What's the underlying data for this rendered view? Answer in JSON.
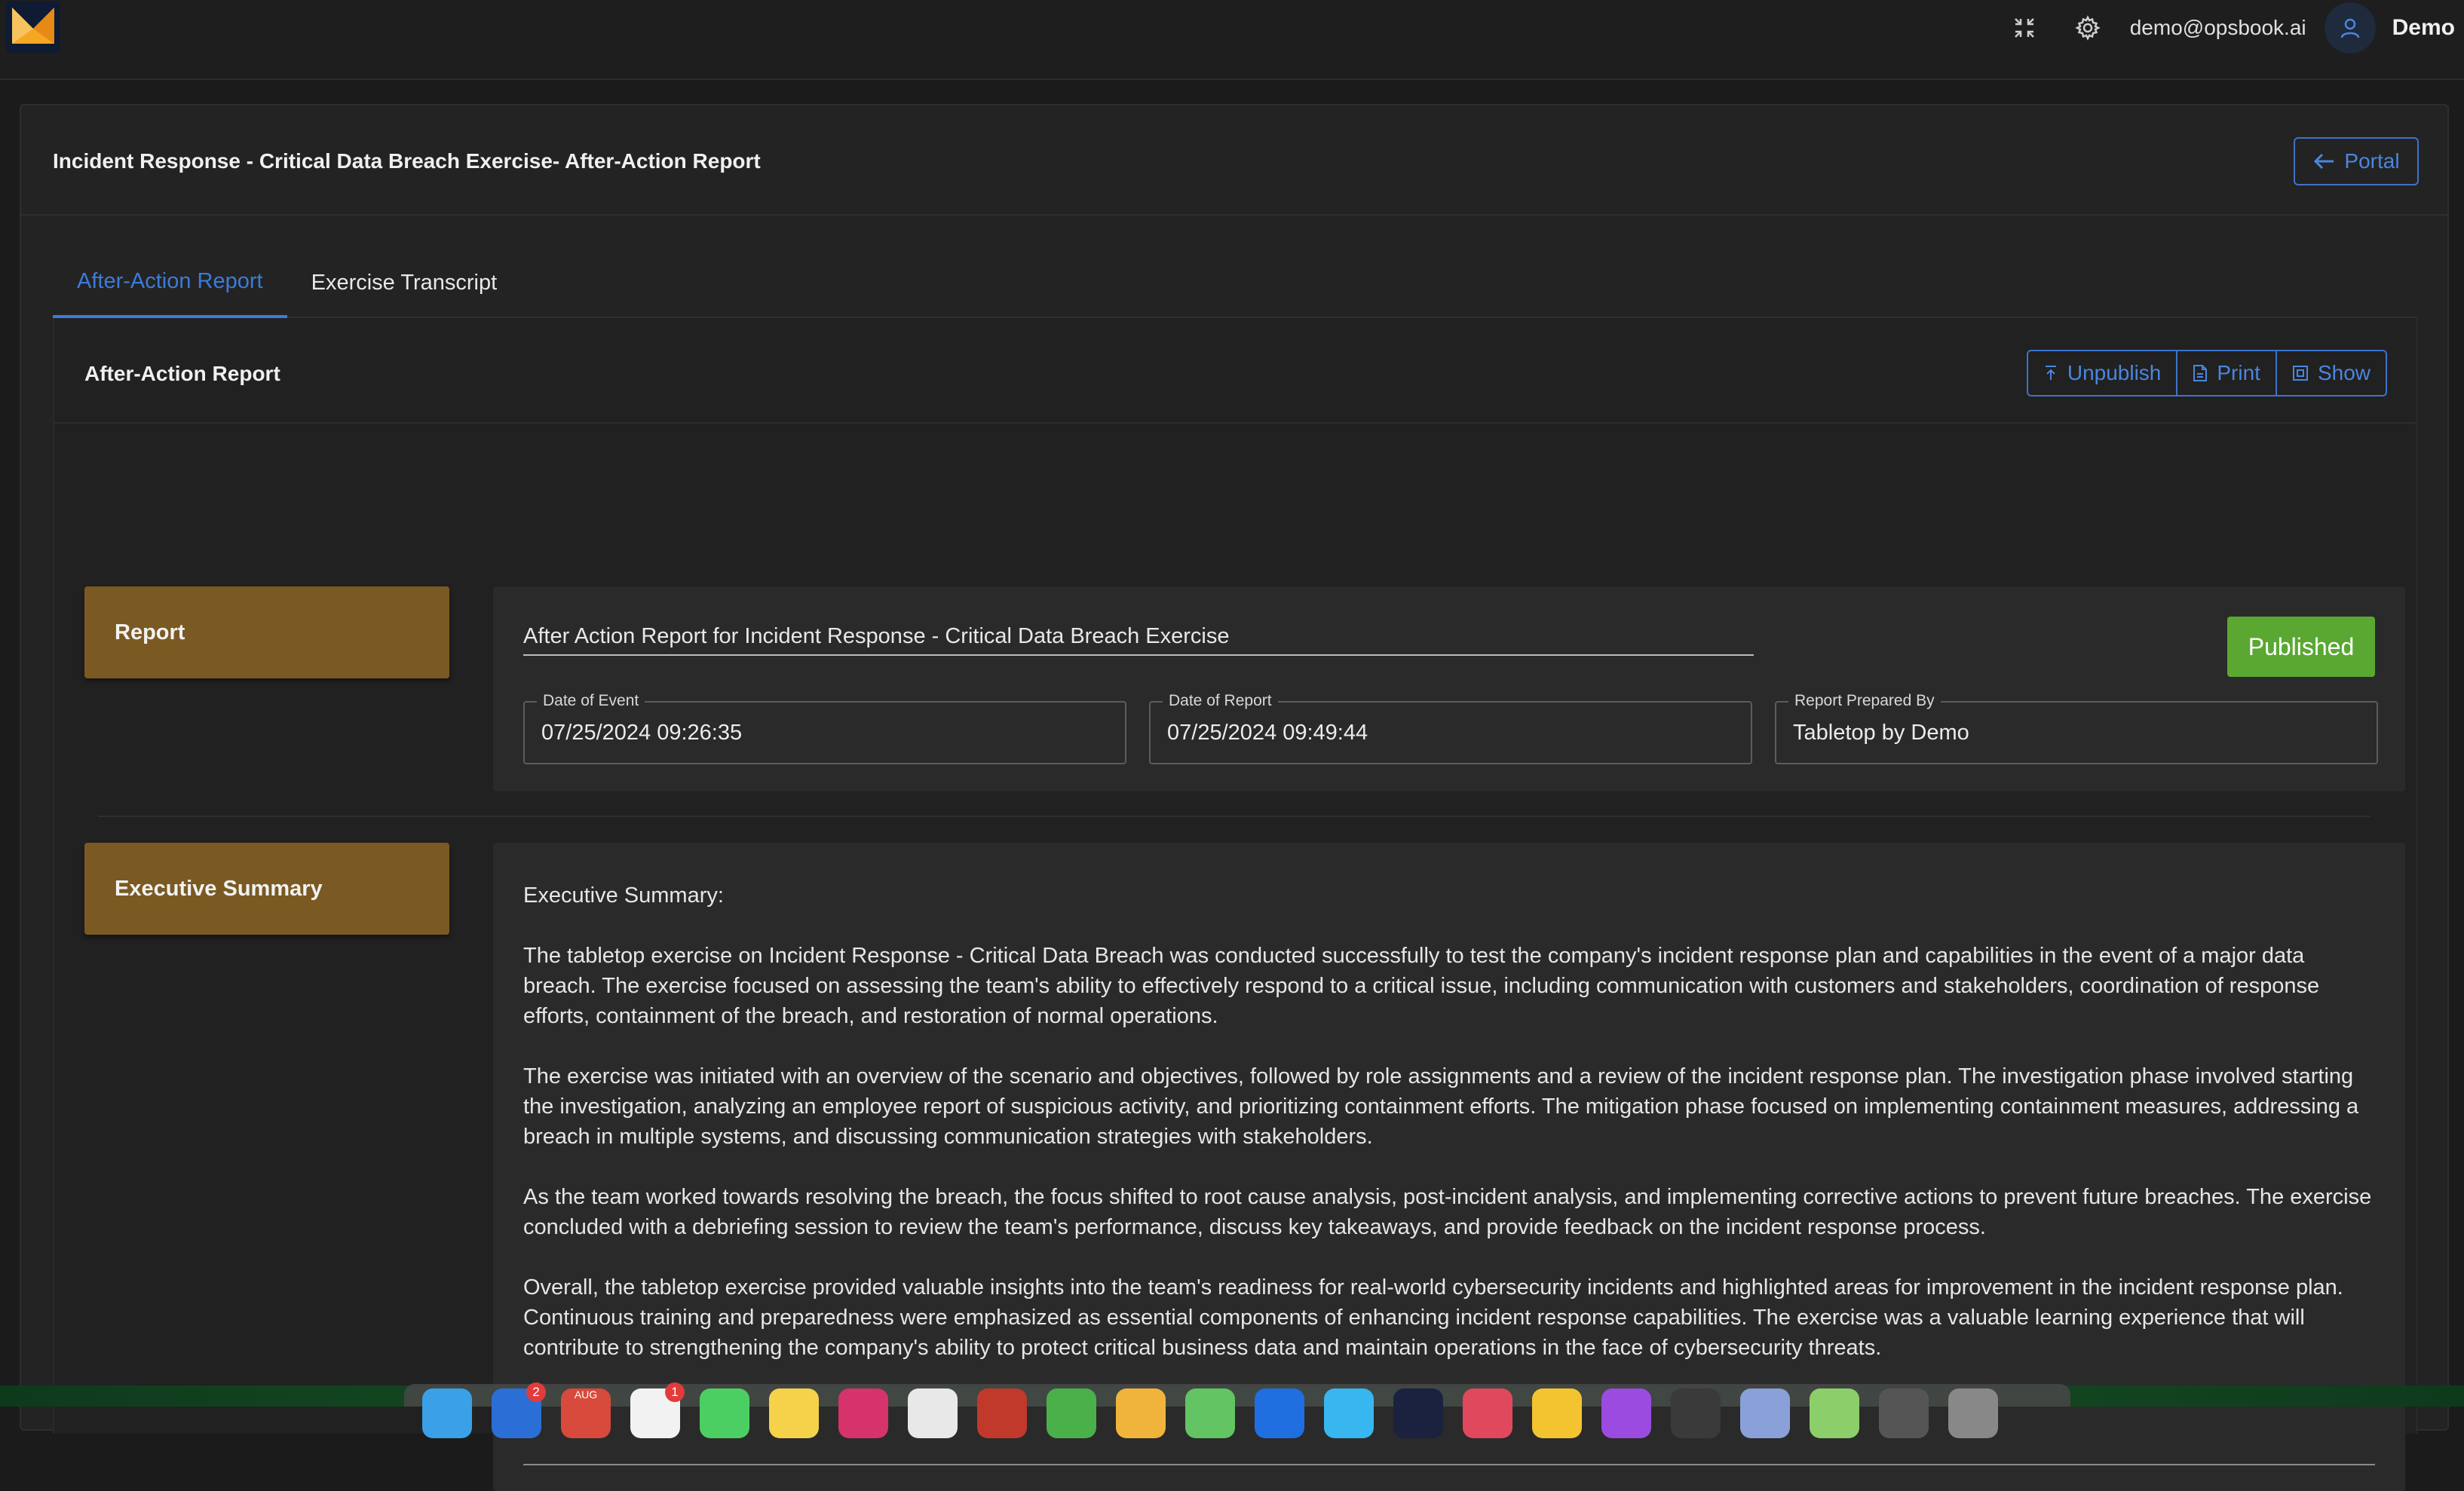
{
  "topbar": {
    "email": "demo@opsbook.ai",
    "username": "Demo",
    "icons": [
      "fullscreen-icon",
      "gear-icon",
      "user-icon"
    ]
  },
  "header": {
    "title": "Incident Response - Critical Data Breach Exercise- After-Action Report",
    "portal_label": "Portal"
  },
  "tabs": [
    {
      "label": "After-Action Report",
      "active": true
    },
    {
      "label": "Exercise Transcript",
      "active": false
    }
  ],
  "section": {
    "title": "After-Action Report",
    "buttons": {
      "unpublish": "Unpublish",
      "print": "Print",
      "show": "Show"
    }
  },
  "report": {
    "side_label": "Report",
    "title_value": "After Action Report for Incident Response -  Critical Data Breach Exercise",
    "status": "Published",
    "status_color": "#5aa832",
    "fields": {
      "date_of_event": {
        "label": "Date of Event",
        "value": "07/25/2024 09:26:35"
      },
      "date_of_report": {
        "label": "Date of Report",
        "value": "07/25/2024 09:49:44"
      },
      "prepared_by": {
        "label": "Report Prepared By",
        "value": "Tabletop by Demo"
      }
    }
  },
  "summary": {
    "side_label": "Executive Summary",
    "heading": "Executive Summary:",
    "paragraphs": [
      "The tabletop exercise on Incident Response - Critical Data Breach was conducted successfully to test the company's incident response plan and capabilities in the event of a major data breach. The exercise focused on assessing the team's ability to effectively respond to a critical issue, including communication with customers and stakeholders, coordination of response efforts, containment of the breach, and restoration of normal operations.",
      "The exercise was initiated with an overview of the scenario and objectives, followed by role assignments and a review of the incident response plan. The investigation phase involved starting the investigation, analyzing an employee report of suspicious activity, and prioritizing containment efforts. The mitigation phase focused on implementing containment measures, addressing a breach in multiple systems, and discussing communication strategies with stakeholders.",
      "As the team worked towards resolving the breach, the focus shifted to root cause analysis, post-incident analysis, and implementing corrective actions to prevent future breaches. The exercise concluded with a debriefing session to review the team's performance, discuss key takeaways, and provide feedback on the incident response process.",
      "Overall, the tabletop exercise provided valuable insights into the team's readiness for real-world cybersecurity incidents and highlighted areas for improvement in the incident response plan. Continuous training and preparedness were emphasized as essential components of enhancing incident response capabilities. The exercise was a valuable learning experience that will contribute to strengthening the company's ability to protect critical business data and maintain operations in the face of cybersecurity threats."
    ]
  },
  "dock": {
    "badges": {
      "mail": "2",
      "calendar": "1"
    },
    "calendar_month": "AUG"
  },
  "colors": {
    "accent": "#3c7bd9",
    "section_label": "#7a5a22",
    "background": "#1b1b1b"
  }
}
